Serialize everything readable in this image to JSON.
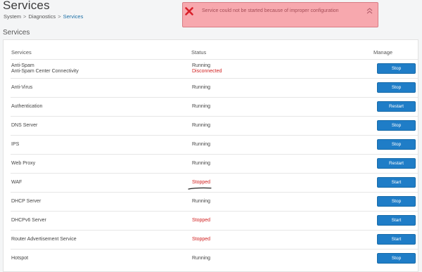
{
  "header": {
    "title": "Services",
    "breadcrumb": [
      "System",
      "Diagnostics",
      "Services"
    ],
    "breadcrumb_sep": ">"
  },
  "section": {
    "title": "Services"
  },
  "alert": {
    "message": "Service could not be started because of improper configuration",
    "icon": "error-x-icon",
    "collapse_icon": "double-chevron-up-icon",
    "colors": {
      "background": "#f7a8ae",
      "icon": "#d81f2a",
      "text": "#a54d57"
    }
  },
  "table": {
    "columns": [
      "Services",
      "Status",
      "Manage"
    ],
    "rows": [
      {
        "name": [
          "Anti-Spam",
          "Anti-Spam Center Connectivity"
        ],
        "status": [
          "Running",
          "Disconnected"
        ],
        "action": "Stop"
      },
      {
        "name": [
          "Anti-Virus"
        ],
        "status": [
          "Running"
        ],
        "action": "Stop"
      },
      {
        "name": [
          "Authentication"
        ],
        "status": [
          "Running"
        ],
        "action": "Restart"
      },
      {
        "name": [
          "DNS Server"
        ],
        "status": [
          "Running"
        ],
        "action": "Stop"
      },
      {
        "name": [
          "IPS"
        ],
        "status": [
          "Running"
        ],
        "action": "Stop"
      },
      {
        "name": [
          "Web Proxy"
        ],
        "status": [
          "Running"
        ],
        "action": "Restart"
      },
      {
        "name": [
          "WAF"
        ],
        "status": [
          "Stopped"
        ],
        "action": "Start"
      },
      {
        "name": [
          "DHCP Server"
        ],
        "status": [
          "Running"
        ],
        "action": "Stop"
      },
      {
        "name": [
          "DHCPv6 Server"
        ],
        "status": [
          "Stopped"
        ],
        "action": "Start"
      },
      {
        "name": [
          "Router Advertisement Service"
        ],
        "status": [
          "Stopped"
        ],
        "action": "Start"
      },
      {
        "name": [
          "Hotspot"
        ],
        "status": [
          "Running"
        ],
        "action": "Stop"
      }
    ]
  },
  "colors": {
    "button": "#1f7dc7",
    "status_bad": "#d11f1f",
    "link": "#1c6fa6"
  }
}
